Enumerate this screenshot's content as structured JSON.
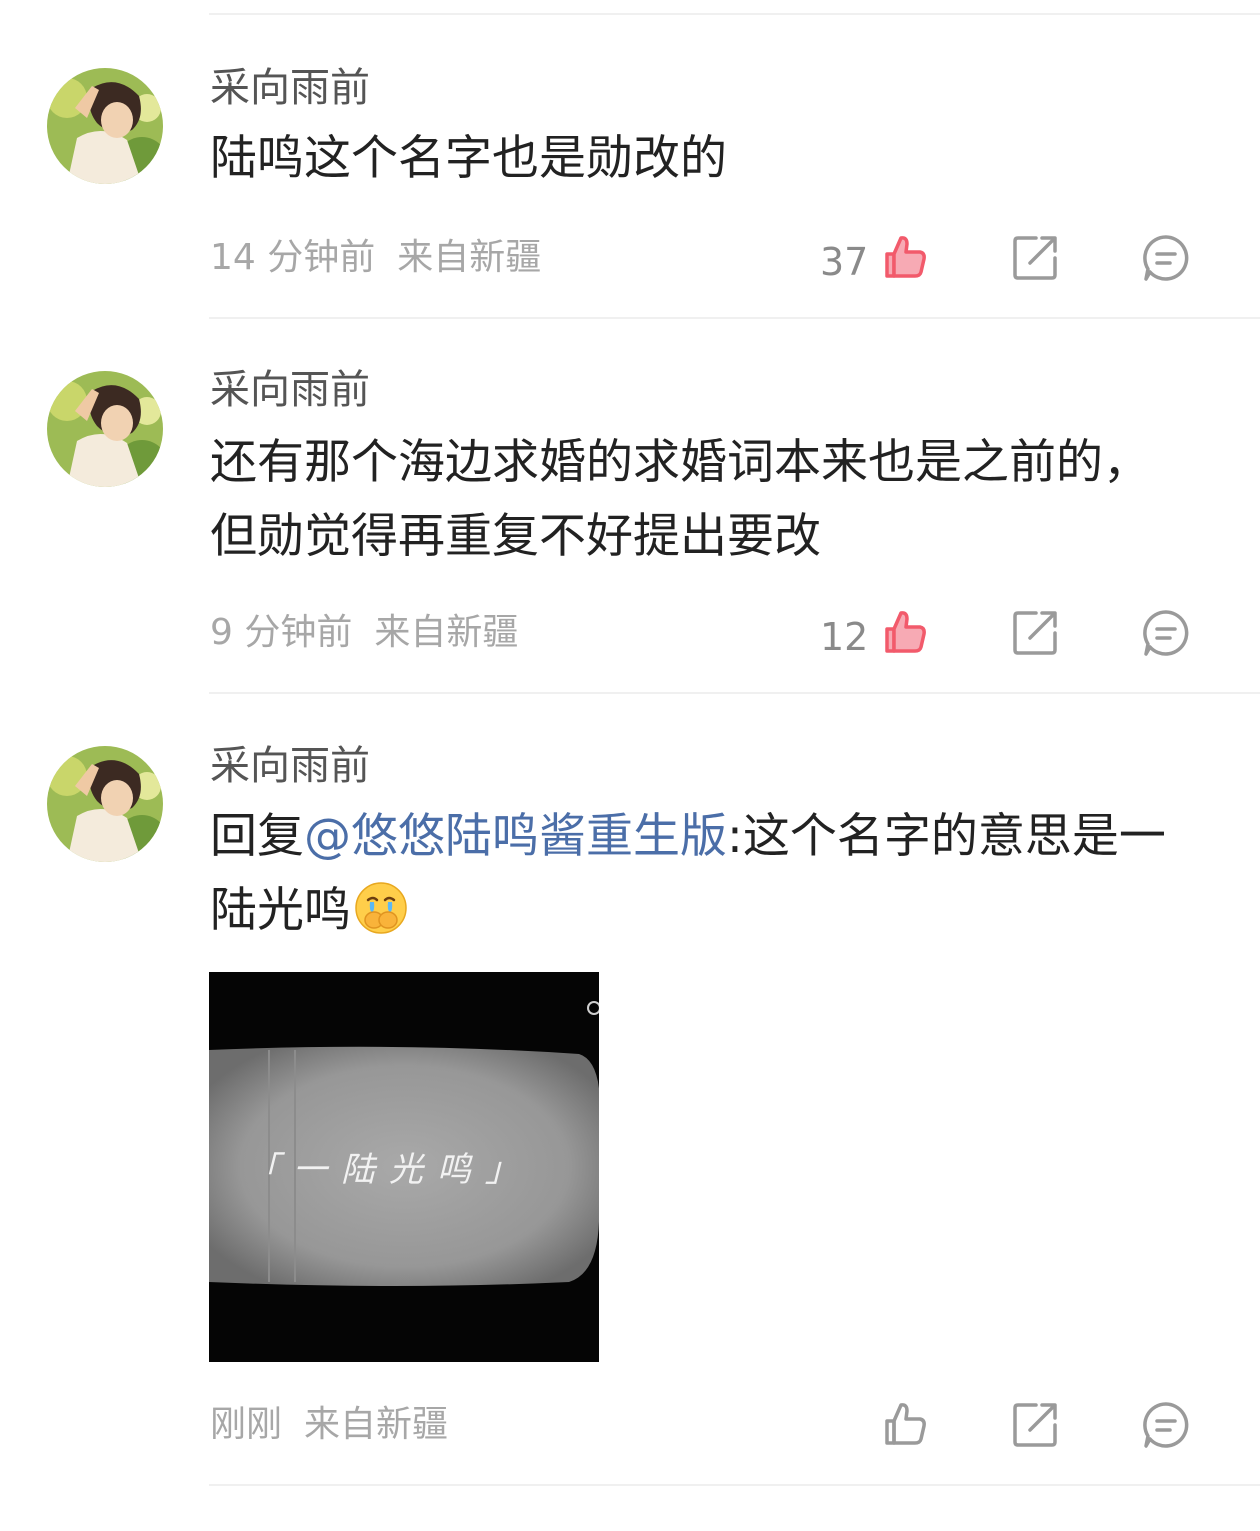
{
  "comments": [
    {
      "username": "采向雨前",
      "text": "陆鸣这个名字也是勋改的",
      "time": "14 分钟前",
      "location": "来自新疆",
      "likes": "37",
      "liked": true
    },
    {
      "username": "采向雨前",
      "text": "还有那个海边求婚的求婚词本来也是之前的，但勋觉得再重复不好提出要改",
      "time": "9 分钟前",
      "location": "来自新疆",
      "likes": "12",
      "liked": true
    },
    {
      "username": "采向雨前",
      "reply_prefix": "回复",
      "mention": "@悠悠陆鸣酱重生版",
      "text_after": ":这个名字的意思是一陆光鸣",
      "emoji": "crying-covering-mouth-emoji",
      "image_caption": "「一陆光鸣」",
      "time": "刚刚",
      "location": "来自新疆",
      "likes": "",
      "liked": false
    }
  ],
  "colors": {
    "like_active": "#f25a6b",
    "icon_gray": "#9a9a9a",
    "mention": "#4b6ea8",
    "meta": "#a7a7a7"
  },
  "icons": {
    "like": "thumbs-up-icon",
    "repost": "share-icon",
    "reply": "comment-icon"
  }
}
